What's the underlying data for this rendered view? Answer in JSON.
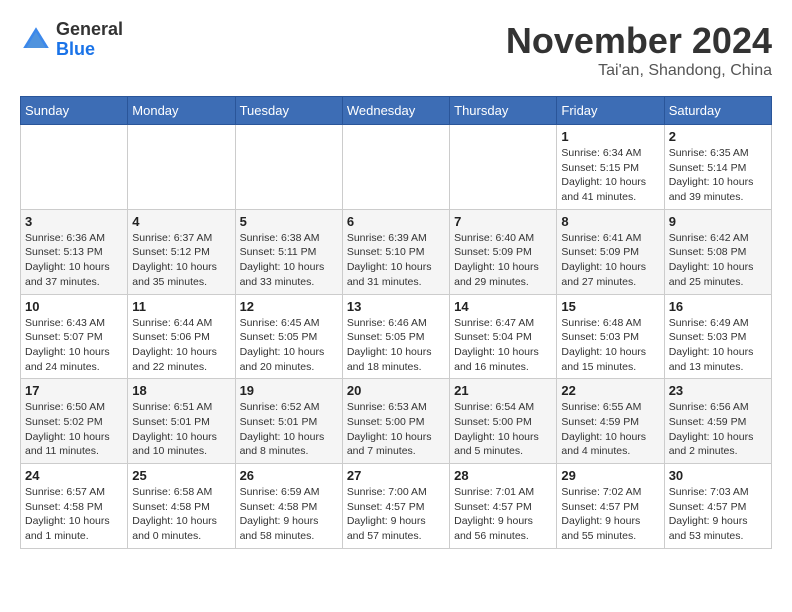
{
  "header": {
    "logo_general": "General",
    "logo_blue": "Blue",
    "month_title": "November 2024",
    "location": "Tai'an, Shandong, China"
  },
  "weekdays": [
    "Sunday",
    "Monday",
    "Tuesday",
    "Wednesday",
    "Thursday",
    "Friday",
    "Saturday"
  ],
  "weeks": [
    [
      {
        "day": "",
        "info": ""
      },
      {
        "day": "",
        "info": ""
      },
      {
        "day": "",
        "info": ""
      },
      {
        "day": "",
        "info": ""
      },
      {
        "day": "",
        "info": ""
      },
      {
        "day": "1",
        "info": "Sunrise: 6:34 AM\nSunset: 5:15 PM\nDaylight: 10 hours and 41 minutes."
      },
      {
        "day": "2",
        "info": "Sunrise: 6:35 AM\nSunset: 5:14 PM\nDaylight: 10 hours and 39 minutes."
      }
    ],
    [
      {
        "day": "3",
        "info": "Sunrise: 6:36 AM\nSunset: 5:13 PM\nDaylight: 10 hours and 37 minutes."
      },
      {
        "day": "4",
        "info": "Sunrise: 6:37 AM\nSunset: 5:12 PM\nDaylight: 10 hours and 35 minutes."
      },
      {
        "day": "5",
        "info": "Sunrise: 6:38 AM\nSunset: 5:11 PM\nDaylight: 10 hours and 33 minutes."
      },
      {
        "day": "6",
        "info": "Sunrise: 6:39 AM\nSunset: 5:10 PM\nDaylight: 10 hours and 31 minutes."
      },
      {
        "day": "7",
        "info": "Sunrise: 6:40 AM\nSunset: 5:09 PM\nDaylight: 10 hours and 29 minutes."
      },
      {
        "day": "8",
        "info": "Sunrise: 6:41 AM\nSunset: 5:09 PM\nDaylight: 10 hours and 27 minutes."
      },
      {
        "day": "9",
        "info": "Sunrise: 6:42 AM\nSunset: 5:08 PM\nDaylight: 10 hours and 25 minutes."
      }
    ],
    [
      {
        "day": "10",
        "info": "Sunrise: 6:43 AM\nSunset: 5:07 PM\nDaylight: 10 hours and 24 minutes."
      },
      {
        "day": "11",
        "info": "Sunrise: 6:44 AM\nSunset: 5:06 PM\nDaylight: 10 hours and 22 minutes."
      },
      {
        "day": "12",
        "info": "Sunrise: 6:45 AM\nSunset: 5:05 PM\nDaylight: 10 hours and 20 minutes."
      },
      {
        "day": "13",
        "info": "Sunrise: 6:46 AM\nSunset: 5:05 PM\nDaylight: 10 hours and 18 minutes."
      },
      {
        "day": "14",
        "info": "Sunrise: 6:47 AM\nSunset: 5:04 PM\nDaylight: 10 hours and 16 minutes."
      },
      {
        "day": "15",
        "info": "Sunrise: 6:48 AM\nSunset: 5:03 PM\nDaylight: 10 hours and 15 minutes."
      },
      {
        "day": "16",
        "info": "Sunrise: 6:49 AM\nSunset: 5:03 PM\nDaylight: 10 hours and 13 minutes."
      }
    ],
    [
      {
        "day": "17",
        "info": "Sunrise: 6:50 AM\nSunset: 5:02 PM\nDaylight: 10 hours and 11 minutes."
      },
      {
        "day": "18",
        "info": "Sunrise: 6:51 AM\nSunset: 5:01 PM\nDaylight: 10 hours and 10 minutes."
      },
      {
        "day": "19",
        "info": "Sunrise: 6:52 AM\nSunset: 5:01 PM\nDaylight: 10 hours and 8 minutes."
      },
      {
        "day": "20",
        "info": "Sunrise: 6:53 AM\nSunset: 5:00 PM\nDaylight: 10 hours and 7 minutes."
      },
      {
        "day": "21",
        "info": "Sunrise: 6:54 AM\nSunset: 5:00 PM\nDaylight: 10 hours and 5 minutes."
      },
      {
        "day": "22",
        "info": "Sunrise: 6:55 AM\nSunset: 4:59 PM\nDaylight: 10 hours and 4 minutes."
      },
      {
        "day": "23",
        "info": "Sunrise: 6:56 AM\nSunset: 4:59 PM\nDaylight: 10 hours and 2 minutes."
      }
    ],
    [
      {
        "day": "24",
        "info": "Sunrise: 6:57 AM\nSunset: 4:58 PM\nDaylight: 10 hours and 1 minute."
      },
      {
        "day": "25",
        "info": "Sunrise: 6:58 AM\nSunset: 4:58 PM\nDaylight: 10 hours and 0 minutes."
      },
      {
        "day": "26",
        "info": "Sunrise: 6:59 AM\nSunset: 4:58 PM\nDaylight: 9 hours and 58 minutes."
      },
      {
        "day": "27",
        "info": "Sunrise: 7:00 AM\nSunset: 4:57 PM\nDaylight: 9 hours and 57 minutes."
      },
      {
        "day": "28",
        "info": "Sunrise: 7:01 AM\nSunset: 4:57 PM\nDaylight: 9 hours and 56 minutes."
      },
      {
        "day": "29",
        "info": "Sunrise: 7:02 AM\nSunset: 4:57 PM\nDaylight: 9 hours and 55 minutes."
      },
      {
        "day": "30",
        "info": "Sunrise: 7:03 AM\nSunset: 4:57 PM\nDaylight: 9 hours and 53 minutes."
      }
    ]
  ]
}
